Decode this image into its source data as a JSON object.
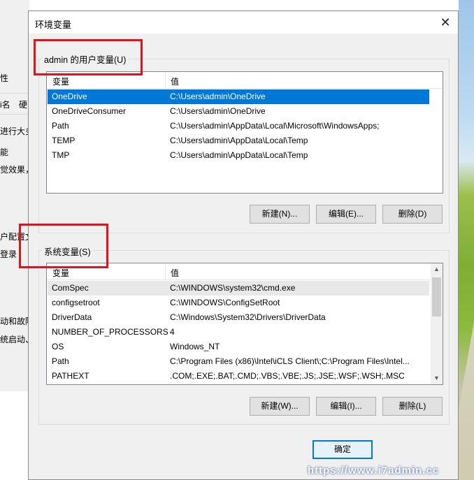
{
  "background": {
    "left_texts": [
      "性",
      "i名",
      "硬",
      "进行大多",
      "能",
      "觉效果，",
      "户配置文",
      "登录",
      "动和故障",
      "统启动、"
    ]
  },
  "dialog": {
    "title": "环境变量",
    "user_vars": {
      "label": "admin 的用户变量(U)",
      "col_var": "变量",
      "col_val": "值",
      "rows": [
        {
          "name": "OneDrive",
          "value": "C:\\Users\\admin\\OneDrive"
        },
        {
          "name": "OneDriveConsumer",
          "value": "C:\\Users\\admin\\OneDrive"
        },
        {
          "name": "Path",
          "value": "C:\\Users\\admin\\AppData\\Local\\Microsoft\\WindowsApps;"
        },
        {
          "name": "TEMP",
          "value": "C:\\Users\\admin\\AppData\\Local\\Temp"
        },
        {
          "name": "TMP",
          "value": "C:\\Users\\admin\\AppData\\Local\\Temp"
        }
      ],
      "buttons": {
        "new": "新建(N)...",
        "edit": "编辑(E)...",
        "delete": "删除(D)"
      }
    },
    "sys_vars": {
      "label": "系统变量(S)",
      "col_var": "变量",
      "col_val": "值",
      "rows": [
        {
          "name": "ComSpec",
          "value": "C:\\WINDOWS\\system32\\cmd.exe"
        },
        {
          "name": "configsetroot",
          "value": "C:\\WINDOWS\\ConfigSetRoot"
        },
        {
          "name": "DriverData",
          "value": "C:\\Windows\\System32\\Drivers\\DriverData"
        },
        {
          "name": "NUMBER_OF_PROCESSORS",
          "value": "4"
        },
        {
          "name": "OS",
          "value": "Windows_NT"
        },
        {
          "name": "Path",
          "value": "C:\\Program Files (x86)\\Intel\\iCLS Client\\;C:\\Program Files\\Intel..."
        },
        {
          "name": "PATHEXT",
          "value": ".COM;.EXE;.BAT;.CMD;.VBS;.VBE;.JS;.JSE;.WSF;.WSH;.MSC"
        }
      ],
      "buttons": {
        "new": "新建(W)...",
        "edit": "编辑(I)...",
        "delete": "删除(L)"
      }
    },
    "ok_label": "确定",
    "close_icon": "close-icon"
  },
  "watermark": "https://www.i7admin.cc",
  "colors": {
    "highlight_box": "#e0121b",
    "selection": "#0078d7"
  }
}
